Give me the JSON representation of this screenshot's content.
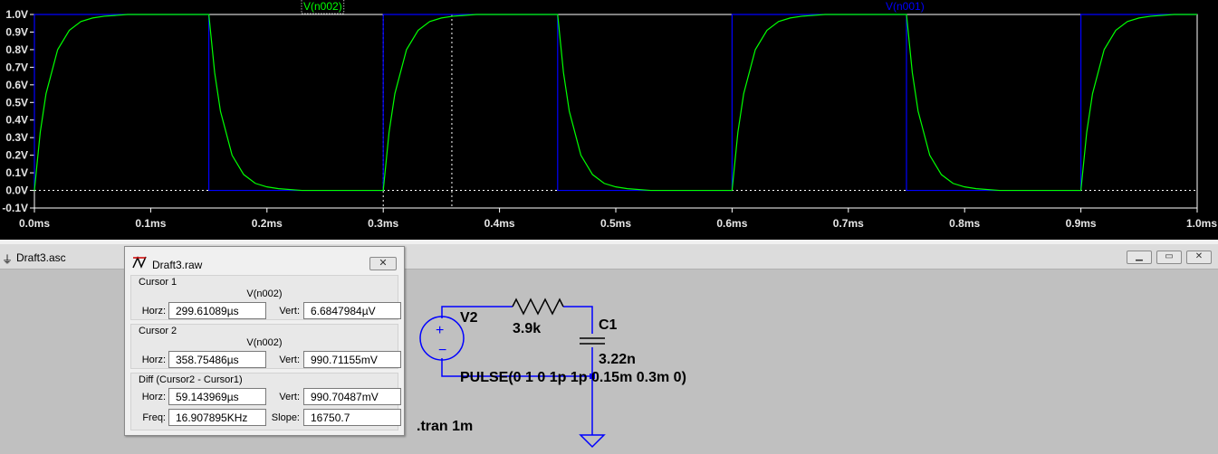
{
  "plot": {
    "x_ticks": [
      "0.0ms",
      "0.1ms",
      "0.2ms",
      "0.3ms",
      "0.4ms",
      "0.5ms",
      "0.6ms",
      "0.7ms",
      "0.8ms",
      "0.9ms",
      "1.0ms"
    ],
    "y_ticks": [
      "1.0V",
      "0.9V",
      "0.8V",
      "0.7V",
      "0.6V",
      "0.5V",
      "0.4V",
      "0.3V",
      "0.2V",
      "0.1V",
      "0.0V",
      "-0.1V"
    ],
    "trace_labels": {
      "n002": "V(n002)",
      "n001": "V(n001)"
    },
    "colors": {
      "n002": "#00ff00",
      "n001": "#0000ff",
      "text": "#e6e6e6",
      "grid": "#ffffff"
    }
  },
  "chart_data": {
    "type": "line",
    "xlabel": "",
    "ylabel": "",
    "x_unit": "ms",
    "xlim": [
      0,
      1.0
    ],
    "ylim": [
      -0.1,
      1.0
    ],
    "grid": false,
    "series": [
      {
        "name": "V(n002)",
        "color": "#00ff00",
        "x": [
          0.0,
          0.005,
          0.01,
          0.02,
          0.03,
          0.04,
          0.05,
          0.06,
          0.08,
          0.15,
          0.155,
          0.16,
          0.17,
          0.18,
          0.19,
          0.2,
          0.21,
          0.23,
          0.3,
          0.305,
          0.31,
          0.32,
          0.33,
          0.34,
          0.35,
          0.36,
          0.38,
          0.45,
          0.455,
          0.46,
          0.47,
          0.48,
          0.49,
          0.5,
          0.51,
          0.53,
          0.6,
          0.605,
          0.61,
          0.62,
          0.63,
          0.64,
          0.65,
          0.66,
          0.68,
          0.75,
          0.755,
          0.76,
          0.77,
          0.78,
          0.79,
          0.8,
          0.81,
          0.83,
          0.9,
          0.905,
          0.91,
          0.92,
          0.93,
          0.94,
          0.95,
          0.96,
          0.98,
          1.0
        ],
        "values": [
          0.0,
          0.33,
          0.55,
          0.8,
          0.91,
          0.96,
          0.98,
          0.99,
          1.0,
          1.0,
          0.67,
          0.45,
          0.2,
          0.09,
          0.04,
          0.02,
          0.01,
          0.0,
          0.0,
          0.33,
          0.55,
          0.8,
          0.91,
          0.96,
          0.98,
          0.99,
          1.0,
          1.0,
          0.67,
          0.45,
          0.2,
          0.09,
          0.04,
          0.02,
          0.01,
          0.0,
          0.0,
          0.33,
          0.55,
          0.8,
          0.91,
          0.96,
          0.98,
          0.99,
          1.0,
          1.0,
          0.67,
          0.45,
          0.2,
          0.09,
          0.04,
          0.02,
          0.01,
          0.0,
          0.0,
          0.33,
          0.55,
          0.8,
          0.91,
          0.96,
          0.98,
          0.99,
          1.0,
          1.0
        ]
      },
      {
        "name": "V(n001)",
        "color": "#0000ff",
        "x": [
          0.0,
          0.0,
          0.15,
          0.15,
          0.3,
          0.3,
          0.45,
          0.45,
          0.6,
          0.6,
          0.75,
          0.75,
          0.9,
          0.9,
          1.0
        ],
        "values": [
          0.0,
          1.0,
          1.0,
          0.0,
          0.0,
          1.0,
          1.0,
          0.0,
          0.0,
          1.0,
          1.0,
          0.0,
          0.0,
          1.0,
          1.0
        ]
      }
    ],
    "cursors": [
      {
        "x": 0.3,
        "y": 0.0
      },
      {
        "x": 0.359,
        "y": 0.99
      }
    ]
  },
  "schematic_window": {
    "title": "Draft3.asc",
    "components": {
      "source_name": "V2",
      "resistor_value": "3.9k",
      "capacitor_name": "C1",
      "capacitor_value": "3.22n",
      "source_value": "PULSE(0 1 0 1p 1p 0.15m 0.3m 0)",
      "directive": ".tran 1m"
    }
  },
  "cursor_dialog": {
    "title": "Draft3.raw",
    "close_label": "✕",
    "cursor1": {
      "group_label": "Cursor 1",
      "signal": "V(n002)",
      "horz_label": "Horz:",
      "horz_value": "299.61089µs",
      "vert_label": "Vert:",
      "vert_value": "6.6847984µV"
    },
    "cursor2": {
      "group_label": "Cursor 2",
      "signal": "V(n002)",
      "horz_label": "Horz:",
      "horz_value": "358.75486µs",
      "vert_label": "Vert:",
      "vert_value": "990.71155mV"
    },
    "diff": {
      "group_label": "Diff (Cursor2 - Cursor1)",
      "horz_label": "Horz:",
      "horz_value": "59.143969µs",
      "vert_label": "Vert:",
      "vert_value": "990.70487mV",
      "freq_label": "Freq:",
      "freq_value": "16.907895KHz",
      "slope_label": "Slope:",
      "slope_value": "16750.7"
    }
  }
}
